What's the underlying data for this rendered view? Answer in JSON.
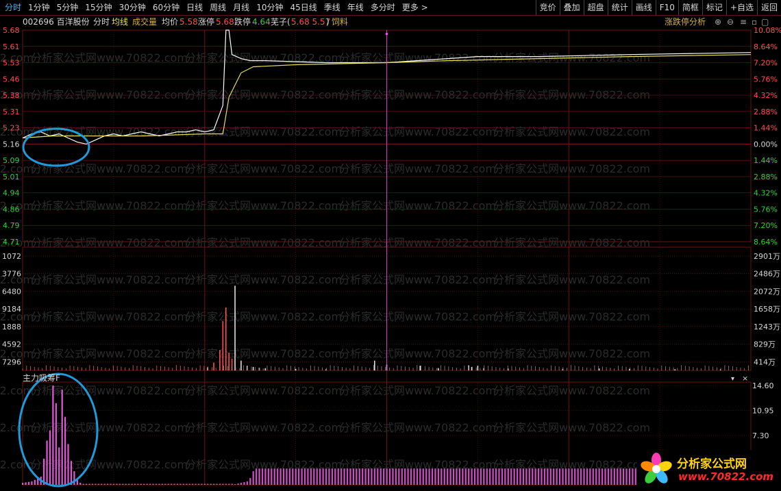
{
  "toolbar": {
    "period_tabs": [
      {
        "label": "分时",
        "active": true
      },
      {
        "label": "1分钟"
      },
      {
        "label": "5分钟"
      },
      {
        "label": "15分钟"
      },
      {
        "label": "30分钟"
      },
      {
        "label": "60分钟"
      },
      {
        "label": "日线"
      },
      {
        "label": "周线"
      },
      {
        "label": "月线"
      },
      {
        "label": "10分钟"
      },
      {
        "label": "45日线"
      },
      {
        "label": "季线"
      },
      {
        "label": "年线"
      },
      {
        "label": "多分时"
      },
      {
        "label": "更多 >"
      }
    ],
    "right_tools": [
      "竞价",
      "叠加",
      "超盘",
      "统计",
      "画线",
      "F10",
      "简框",
      "标记",
      "+自选",
      "返回"
    ]
  },
  "info": {
    "code_name": "002696 百洋股份",
    "mode": "分时",
    "avg_line": "均线",
    "volume_label": "成交量",
    "avg_price_label": "均价",
    "avg_price": "5.58",
    "limit_up_label": "涨停",
    "limit_up": "5.68",
    "limit_down_label": "跌停",
    "limit_down": "4.64",
    "sector_label": "芜子(",
    "sector_vals": "5.68 5.57",
    "sector_close": ")",
    "sector_tag": "饲料",
    "right_link": "涨跌停分析"
  },
  "colors": {
    "up": "#ff5050",
    "down": "#3dcc3d",
    "price_line": "#ffffff",
    "avg_line": "#e8e05a",
    "grid": "#6e1414",
    "cursor": "#ff3cff",
    "indicator": "#d14ec6"
  },
  "chart_data": [
    {
      "type": "line",
      "name": "分时",
      "prev_close": 5.16,
      "ylim": [
        4.64,
        5.68
      ],
      "y_ticks_left": [
        "5.68",
        "5.61",
        "5.53",
        "5.46",
        "5.38",
        "5.31",
        "5.23",
        "5.16",
        "5.09",
        "5.01",
        "4.94",
        "4.86",
        "4.79",
        "4.71"
      ],
      "y_ticks_right": [
        "10.08%",
        "8.64%",
        "7.20%",
        "5.76%",
        "4.32%",
        "2.88%",
        "1.44%",
        "0.00%",
        "1.44%",
        "2.88%",
        "4.32%",
        "5.76%",
        "7.20%",
        "8.64%"
      ],
      "minutes_total": 240,
      "price": [
        [
          0,
          5.15
        ],
        [
          3,
          5.17
        ],
        [
          6,
          5.18
        ],
        [
          9,
          5.16
        ],
        [
          12,
          5.17
        ],
        [
          15,
          5.15
        ],
        [
          18,
          5.13
        ],
        [
          21,
          5.12
        ],
        [
          24,
          5.14
        ],
        [
          27,
          5.16
        ],
        [
          30,
          5.17
        ],
        [
          33,
          5.16
        ],
        [
          36,
          5.17
        ],
        [
          39,
          5.18
        ],
        [
          42,
          5.17
        ],
        [
          45,
          5.16
        ],
        [
          48,
          5.17
        ],
        [
          51,
          5.18
        ],
        [
          54,
          5.18
        ],
        [
          57,
          5.19
        ],
        [
          60,
          5.18
        ],
        [
          63,
          5.19
        ],
        [
          66,
          5.31
        ],
        [
          67,
          5.68
        ],
        [
          68,
          5.68
        ],
        [
          69,
          5.56
        ],
        [
          72,
          5.54
        ],
        [
          75,
          5.53
        ],
        [
          80,
          5.53
        ],
        [
          100,
          5.52
        ],
        [
          120,
          5.52
        ],
        [
          140,
          5.54
        ],
        [
          150,
          5.55
        ],
        [
          170,
          5.55
        ],
        [
          200,
          5.56
        ],
        [
          240,
          5.57
        ]
      ],
      "avg": [
        [
          0,
          5.15
        ],
        [
          10,
          5.16
        ],
        [
          20,
          5.16
        ],
        [
          40,
          5.16
        ],
        [
          60,
          5.17
        ],
        [
          66,
          5.17
        ],
        [
          68,
          5.35
        ],
        [
          72,
          5.47
        ],
        [
          76,
          5.5
        ],
        [
          90,
          5.51
        ],
        [
          120,
          5.52
        ],
        [
          140,
          5.53
        ],
        [
          170,
          5.54
        ],
        [
          200,
          5.55
        ],
        [
          240,
          5.56
        ]
      ],
      "cursor_minute": 120
    },
    {
      "type": "bar",
      "name": "成交量",
      "y_ticks_left": [
        "1072",
        "3776",
        "6480",
        "9184",
        "1888",
        "4592",
        "7296"
      ],
      "y_ticks_right": [
        "2901万",
        "2486万",
        "2072万",
        "1658万",
        "1243万",
        "829万",
        "414万"
      ],
      "volume_wan": [
        {
          "m": 61,
          "v": 80
        },
        {
          "m": 63,
          "v": 200
        },
        {
          "m": 65,
          "v": 520
        },
        {
          "m": 66,
          "v": 1250
        },
        {
          "m": 67,
          "v": 1600
        },
        {
          "m": 68,
          "v": 450
        },
        {
          "m": 69,
          "v": 300
        },
        {
          "m": 70,
          "v": 2150
        },
        {
          "m": 72,
          "v": 250
        },
        {
          "m": 74,
          "v": 120
        },
        {
          "m": 76,
          "v": 90
        },
        {
          "m": 78,
          "v": 70
        },
        {
          "m": 80,
          "v": 60
        },
        {
          "m": 90,
          "v": 40
        },
        {
          "m": 100,
          "v": 30
        },
        {
          "m": 116,
          "v": 250
        },
        {
          "m": 120,
          "v": 150
        },
        {
          "m": 131,
          "v": 120
        },
        {
          "m": 137,
          "v": 60
        },
        {
          "m": 147,
          "v": 130
        },
        {
          "m": 148,
          "v": 90
        },
        {
          "m": 150,
          "v": 120
        },
        {
          "m": 152,
          "v": 60
        },
        {
          "m": 160,
          "v": 50
        },
        {
          "m": 178,
          "v": 40
        },
        {
          "m": 190,
          "v": 50
        },
        {
          "m": 200,
          "v": 40
        },
        {
          "m": 215,
          "v": 30
        },
        {
          "m": 230,
          "v": 30
        }
      ]
    },
    {
      "type": "bar",
      "name": "主力吸筹F",
      "y_ticks_right": [
        "14.60",
        "10.95",
        "7.30"
      ],
      "values": [
        {
          "m": 0,
          "v": 0.3
        },
        {
          "m": 3,
          "v": 0.5
        },
        {
          "m": 6,
          "v": 1.2
        },
        {
          "m": 8,
          "v": 6.5
        },
        {
          "m": 9,
          "v": 8.0
        },
        {
          "m": 10,
          "v": 14.6
        },
        {
          "m": 11,
          "v": 12.0
        },
        {
          "m": 12,
          "v": 5.5
        },
        {
          "m": 13,
          "v": 14.0
        },
        {
          "m": 14,
          "v": 10.0
        },
        {
          "m": 15,
          "v": 6.0
        },
        {
          "m": 16,
          "v": 3.5
        },
        {
          "m": 17,
          "v": 2.0
        },
        {
          "m": 18,
          "v": 0.8
        },
        {
          "m": 19,
          "v": 0.3
        },
        {
          "m": 70,
          "v": 0.1
        },
        {
          "m": 74,
          "v": 0.5
        },
        {
          "m": 75,
          "v": 1.0
        },
        {
          "m": 76,
          "v": 2.0
        },
        {
          "m": 77,
          "v": 2.4
        },
        {
          "m": 200,
          "v": 2.4
        },
        {
          "m": 240,
          "v": 2.4
        }
      ]
    }
  ],
  "sub_indicator": "主力吸筹F",
  "watermark": "分析家公式网www.70822.com",
  "logo": {
    "text": "分析家公式网",
    "url": "www.70822.com"
  }
}
